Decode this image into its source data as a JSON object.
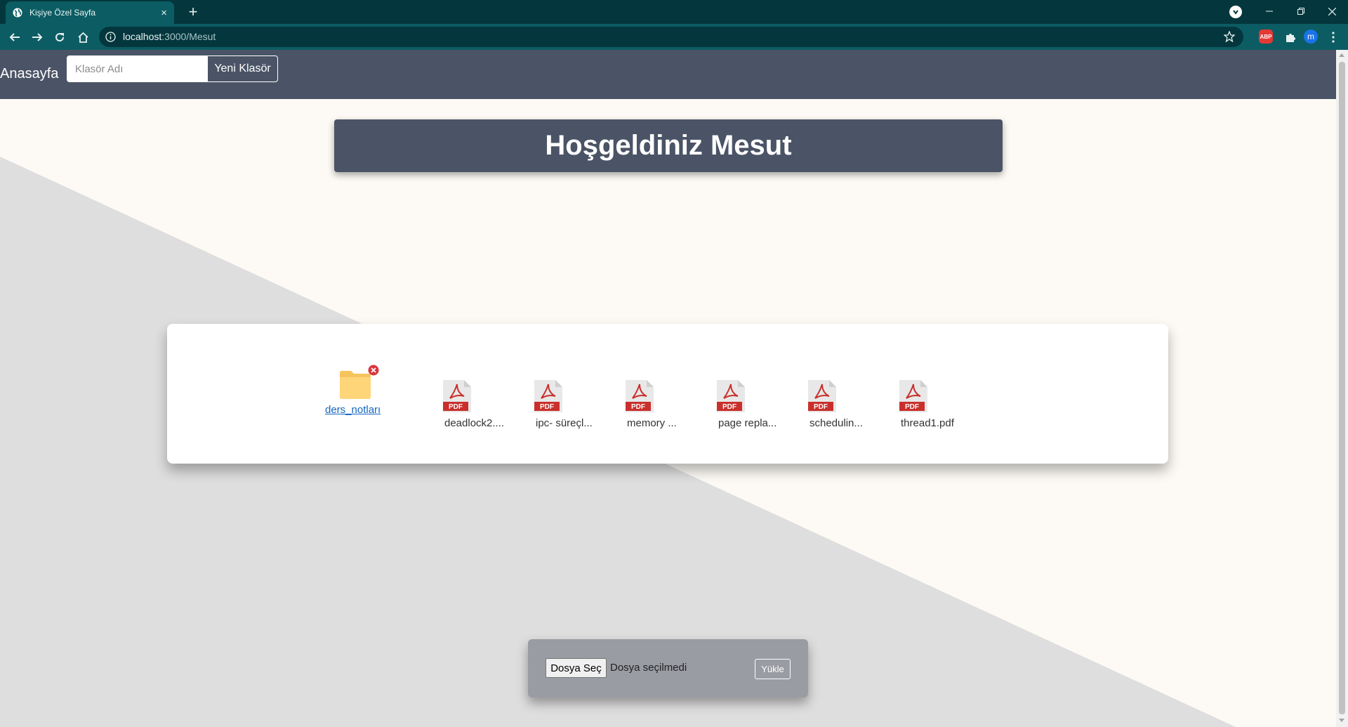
{
  "browser": {
    "tab_title": "Kişiye Özel Sayfa",
    "tab_close": "×",
    "new_tab": "+",
    "url_host": "localhost",
    "url_rest": ":3000/Mesut",
    "extensions": [
      {
        "name": "adblock-plus",
        "label": "ABP",
        "color": "#e53935"
      },
      {
        "name": "profile",
        "label": "m",
        "color": "#1a73e8"
      }
    ]
  },
  "navbar": {
    "brand": "Anasayfa",
    "folder_input_placeholder": "Klasör Adı",
    "new_folder_button": "Yeni Klasör"
  },
  "welcome": {
    "title": "Hoşgeldiniz Mesut"
  },
  "files": {
    "folders": [
      {
        "name": "ders_notları",
        "icon": "folder-icon"
      }
    ],
    "pdfs": [
      {
        "label": "deadlock2....",
        "icon": "pdf-icon"
      },
      {
        "label": "ipc- süreçl...",
        "icon": "pdf-icon"
      },
      {
        "label": "memory ...",
        "icon": "pdf-icon"
      },
      {
        "label": "page repla...",
        "icon": "pdf-icon"
      },
      {
        "label": "schedulin...",
        "icon": "pdf-icon"
      },
      {
        "label": "thread1.pdf",
        "icon": "pdf-icon"
      }
    ]
  },
  "upload": {
    "choose_button": "Dosya Seç",
    "no_file_text": "Dosya seçilmedi",
    "upload_button": "Yükle"
  },
  "colors": {
    "chrome_dark": "#03373d",
    "chrome_toolbar": "#0c5c63",
    "navbar": "#4b5466",
    "page_bg": "#fdfaf5",
    "diagonal_gray": "#dedede",
    "upload_panel": "#9a9ca3"
  }
}
